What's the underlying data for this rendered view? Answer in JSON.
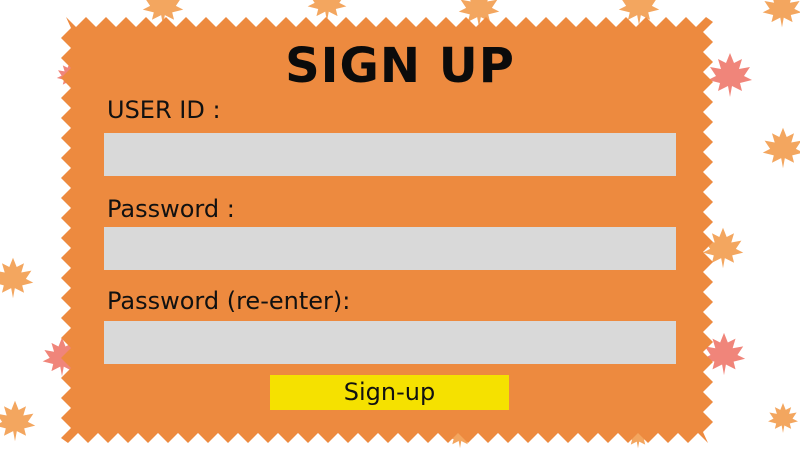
{
  "form": {
    "title": "SIGN UP",
    "user_id_label": "USER ID :",
    "user_id_value": "",
    "password_label": "Password :",
    "password_value": "",
    "password_reenter_label": "Password (re-enter):",
    "password_reenter_value": "",
    "submit_label": "Sign-up"
  },
  "colors": {
    "panel": "#ed8a3f",
    "field": "#d9d9d9",
    "button": "#f5e100",
    "leaf_orange": "#f3a65f",
    "leaf_pink": "#f0857a"
  },
  "decorations": {
    "background_icon": "maple-leaf-icon"
  }
}
